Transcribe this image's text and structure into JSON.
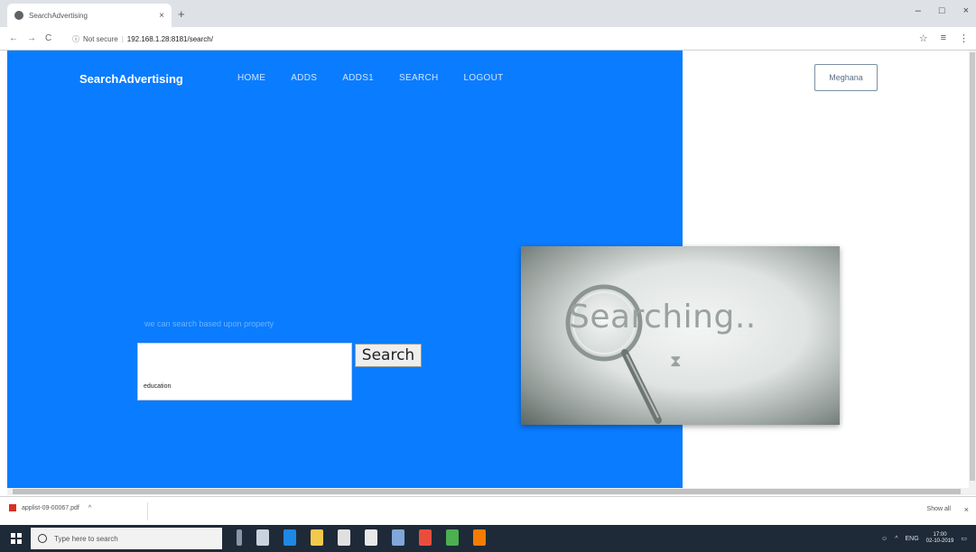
{
  "browser": {
    "tab_title": "SearchAdvertising",
    "tab_close": "×",
    "new_tab": "+",
    "window_controls": [
      "–",
      "□",
      "×"
    ],
    "nav": {
      "back": "←",
      "forward": "→",
      "reload": "C"
    },
    "security_label": "Not secure",
    "url": "192.168.1.28:8181/search/",
    "toolbar_icons": [
      "☆",
      "≡",
      "⋮"
    ]
  },
  "page": {
    "brand": "SearchAdvertising",
    "nav_items": [
      "HOME",
      "ADDS",
      "ADDS1",
      "SEARCH",
      "LOGOUT"
    ],
    "user_button": "Meghana",
    "search_caption": "we can search based upon property",
    "search_value": "education",
    "search_button": "Search",
    "promo_text": "Searching..",
    "colors": {
      "panel": "#0a7cff",
      "nav_text": "#cfe6ff"
    }
  },
  "downloads": {
    "file": "applist-09-00067.pdf",
    "file_menu": "^",
    "show_all": "Show all",
    "close": "×"
  },
  "taskbar": {
    "search_placeholder": "Type here to search",
    "tray_text": "ENG",
    "time": "17:00",
    "date": "02-10-2019"
  }
}
